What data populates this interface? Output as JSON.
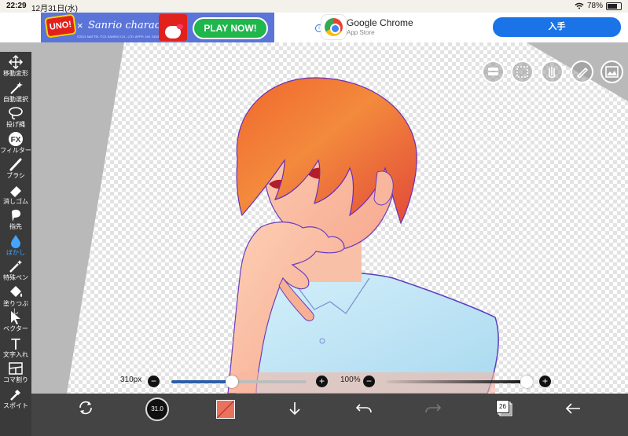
{
  "status_bar": {
    "time": "22:29",
    "date": "12月31日(水)",
    "battery": "78%",
    "battery_level": 0.78
  },
  "ad": {
    "uno_logo": "UNO!",
    "uno_x": "×",
    "uno_brand": "Sanrio characters",
    "uno_copyright": "©2021 MATTEL ©'21 SANRIO CO., LTD. APPR. NO. S615479",
    "play_now": "PLAY NOW!",
    "info_glyph": "i",
    "app_name": "Google Chrome",
    "app_store": "App Store",
    "get_button": "入手"
  },
  "left_toolbar": {
    "tools": [
      {
        "label": "移動変形",
        "icon": "move-arrows-icon"
      },
      {
        "label": "自動選択",
        "icon": "magic-wand-icon"
      },
      {
        "label": "投げ縄",
        "icon": "lasso-icon"
      },
      {
        "label": "フィルター",
        "icon": "fx-icon",
        "glyph": "FX"
      },
      {
        "label": "ブラシ",
        "icon": "brush-icon"
      },
      {
        "label": "消しゴム",
        "icon": "eraser-icon"
      },
      {
        "label": "指先",
        "icon": "finger-smudge-icon"
      },
      {
        "label": "ぼかし",
        "icon": "blur-drop-icon"
      },
      {
        "label": "特殊ペン",
        "icon": "special-pen-icon"
      },
      {
        "label": "塗りつぶし",
        "icon": "fill-bucket-icon"
      },
      {
        "label": "ベクター",
        "icon": "vector-cursor-icon"
      },
      {
        "label": "文字入れ",
        "icon": "text-icon",
        "glyph": "T"
      },
      {
        "label": "コマ割り",
        "icon": "panel-divide-icon"
      },
      {
        "label": "スポイト",
        "icon": "eyedropper-icon"
      }
    ],
    "active_tool": "ぼかし",
    "active_color": "#43a5ff"
  },
  "right_tools": [
    "layer-settings-icon",
    "selection-icon",
    "hand-gesture-icon",
    "pen-edit-icon",
    "image-insert-icon"
  ],
  "brush_size": {
    "label": "310px",
    "minus": "−",
    "plus": "+",
    "level": 0.45
  },
  "opacity": {
    "label": "100%",
    "minus": "−",
    "plus": "+",
    "level": 1.0
  },
  "bottom_bar": {
    "brush_preview_value": "31.0",
    "layer_count": "26",
    "color_swatch": "#e9725d",
    "icons": [
      "transform-icon",
      "brush-preview-icon",
      "color-swatch-icon",
      "download-arrow-icon",
      "undo-icon",
      "redo-icon",
      "layers-icon",
      "back-arrow-icon"
    ]
  },
  "colors": {
    "accent": "#43a5ff",
    "toolbar_bg": "#3a3a3a",
    "bottom_bg": "#444444",
    "track_blue": "#2e5ea6"
  }
}
